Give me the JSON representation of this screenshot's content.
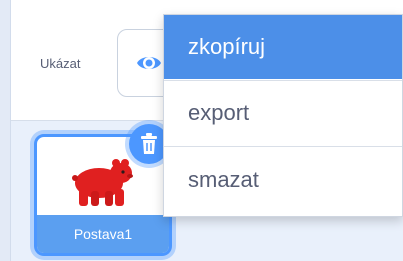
{
  "sprite_info": {
    "show_label": "Ukázat",
    "visibility_icon": "eye-icon"
  },
  "sprite_list": {
    "sprites": [
      {
        "name": "Postava1",
        "selected": true,
        "thumbnail_icon": "bear-costume-icon"
      }
    ],
    "delete_icon": "trash-icon"
  },
  "context_menu": {
    "items": [
      {
        "label": "zkopíruj",
        "highlighted": true
      },
      {
        "label": "export",
        "highlighted": false
      },
      {
        "label": "smazat",
        "highlighted": false
      }
    ]
  },
  "colors": {
    "accent": "#4c97ff",
    "menu_highlight": "#4c8fe8",
    "text": "#575e75",
    "sprite_fill": "#e02020"
  }
}
